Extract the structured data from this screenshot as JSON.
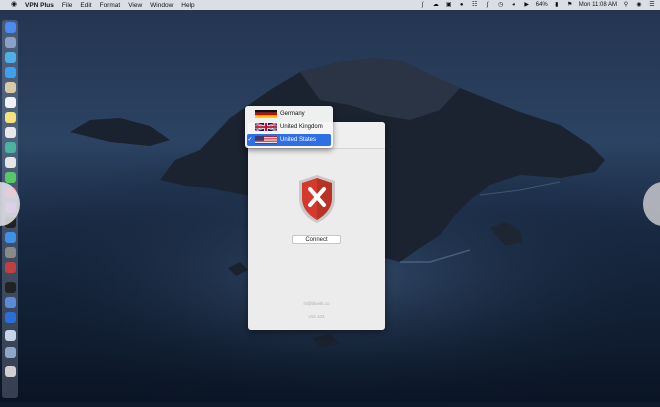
{
  "menubar": {
    "app_name": "VPN Plus",
    "items": [
      "File",
      "Edit",
      "Format",
      "View",
      "Window",
      "Help"
    ],
    "battery": "64%",
    "clock": "Mon 11:08 AM"
  },
  "vpn_window": {
    "connect_label": "Connect",
    "email": "hi@bluetk.co",
    "version": "v16.103",
    "status_color": "#d33a2c"
  },
  "country_menu": {
    "items": [
      {
        "label": "Germany",
        "selected": false
      },
      {
        "label": "United Kingdom",
        "selected": false
      },
      {
        "label": "United States",
        "selected": true
      }
    ],
    "accent": "#2f6fe4"
  }
}
